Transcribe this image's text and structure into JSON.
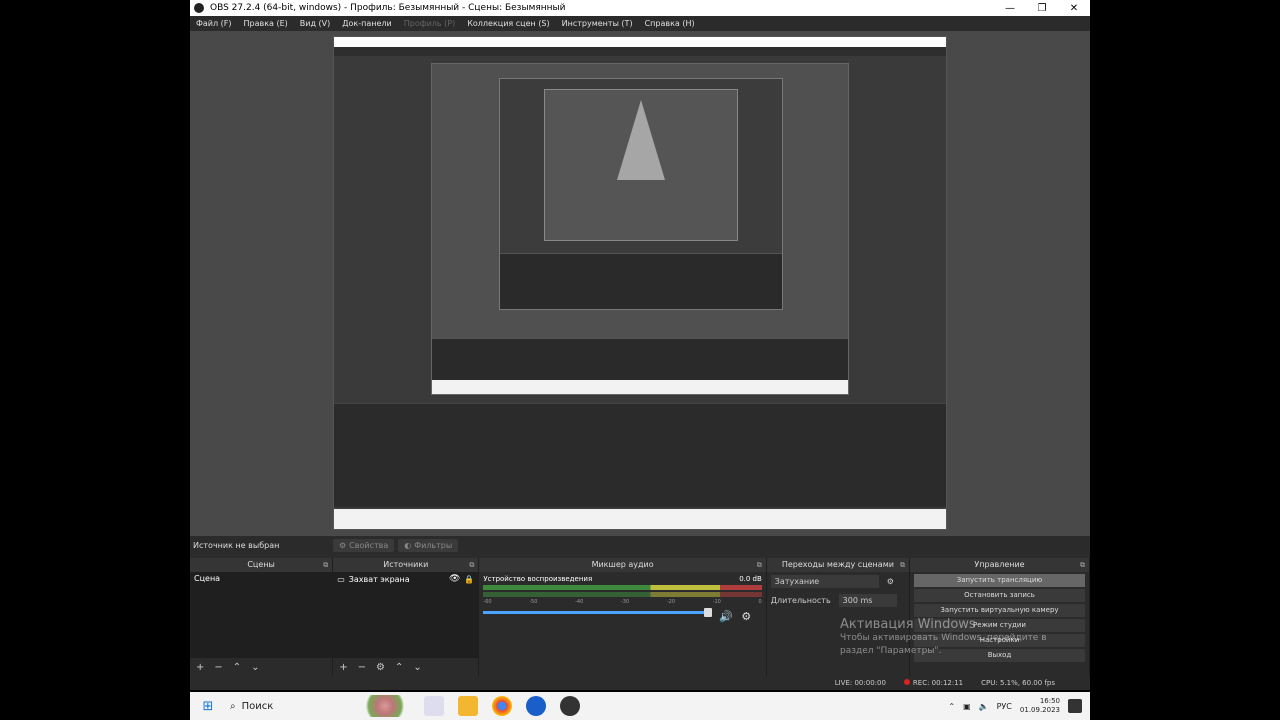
{
  "window": {
    "title": "OBS 27.2.4 (64-bit, windows) - Профиль: Безымянный - Сцены: Безымянный",
    "controls": [
      "—",
      "❐",
      "✕"
    ]
  },
  "menu": {
    "items": [
      {
        "label": "Файл (F)",
        "disabled": false
      },
      {
        "label": "Правка (E)",
        "disabled": false
      },
      {
        "label": "Вид (V)",
        "disabled": false
      },
      {
        "label": "Док-панели",
        "disabled": false
      },
      {
        "label": "Профиль (P)",
        "disabled": true
      },
      {
        "label": "Коллекция сцен (S)",
        "disabled": false
      },
      {
        "label": "Инструменты (T)",
        "disabled": false
      },
      {
        "label": "Справка (H)",
        "disabled": false
      }
    ]
  },
  "source_bar": {
    "status": "Источник не выбран",
    "properties": "Свойства",
    "filters": "Фильтры"
  },
  "docks": {
    "scenes": {
      "title": "Сцены",
      "items": [
        "Сцена"
      ]
    },
    "sources": {
      "title": "Источники",
      "items": [
        "Захват экрана"
      ]
    },
    "mixer": {
      "title": "Микшер аудио",
      "device": "Устройство воспроизведения",
      "db": "0.0 dB"
    },
    "transitions": {
      "title": "Переходы между сценами",
      "type": "Затухание",
      "duration_label": "Длительность",
      "duration": "300 ms"
    },
    "controls": {
      "title": "Управление",
      "buttons": [
        "Запустить трансляцию",
        "Остановить запись",
        "Запустить виртуальную камеру",
        "Режим студии",
        "Настройки",
        "Выход"
      ]
    }
  },
  "activation": {
    "title": "Активация Windows",
    "line1": "Чтобы активировать Windows, перейдите в",
    "line2": "раздел \"Параметры\"."
  },
  "status": {
    "live": "LIVE: 00:00:00",
    "rec": "REC: 00:12:11",
    "cpu": "CPU: 5.1%, 60.00 fps"
  },
  "taskbar": {
    "search": "Поиск",
    "lang": "РУС",
    "time": "16:50",
    "date": "01.09.2023"
  }
}
